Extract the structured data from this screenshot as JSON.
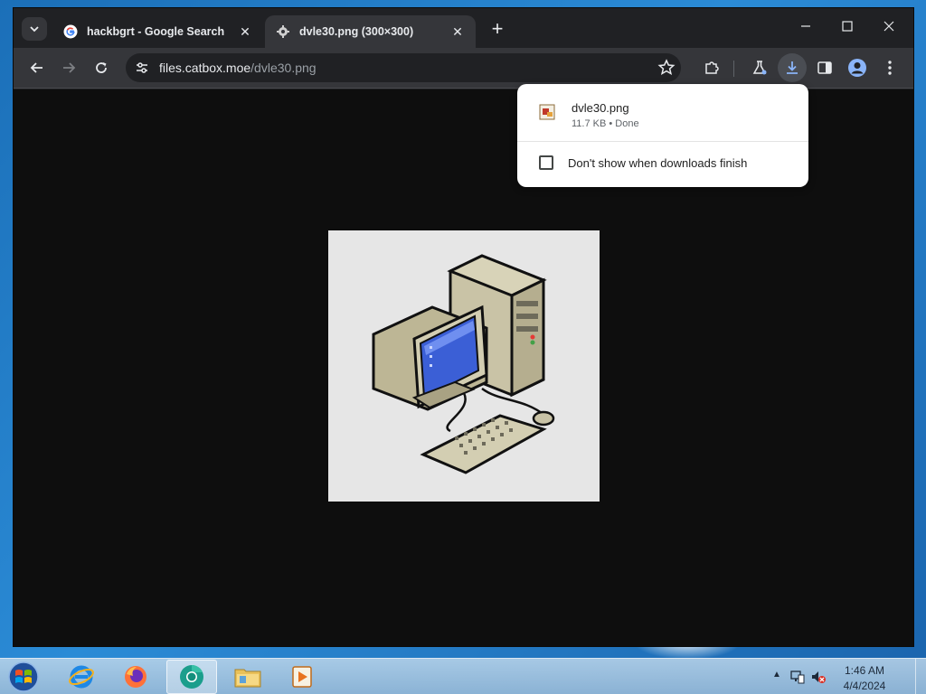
{
  "browser": {
    "tabs": [
      {
        "title": "hackbgrt - Google Search",
        "favicon": "google-g-icon",
        "active": false
      },
      {
        "title": "dvle30.png (300×300)",
        "favicon": "gear-favicon-icon",
        "active": true
      }
    ],
    "omnibox": {
      "host": "files.catbox.moe",
      "path": "/dvle30.png"
    }
  },
  "download_bubble": {
    "file_name": "dvle30.png",
    "file_meta": "11.7 KB • Done",
    "checkbox_label": "Don't show when downloads finish",
    "checkbox_checked": false
  },
  "image": {
    "description_icon": "retro-computer-pixel-art",
    "width": 300,
    "height": 300
  },
  "taskbar": {
    "apps": [
      "internet-explorer",
      "firefox",
      "chrome",
      "file-explorer",
      "media-player"
    ],
    "active_app": "chrome",
    "clock_time": "1:46 AM",
    "clock_date": "4/4/2024"
  },
  "colors": {
    "tab_bg": "#202124",
    "toolbar_bg": "#35363a",
    "page_bg": "#0e0e0e",
    "image_bg": "#e6e6e6"
  }
}
